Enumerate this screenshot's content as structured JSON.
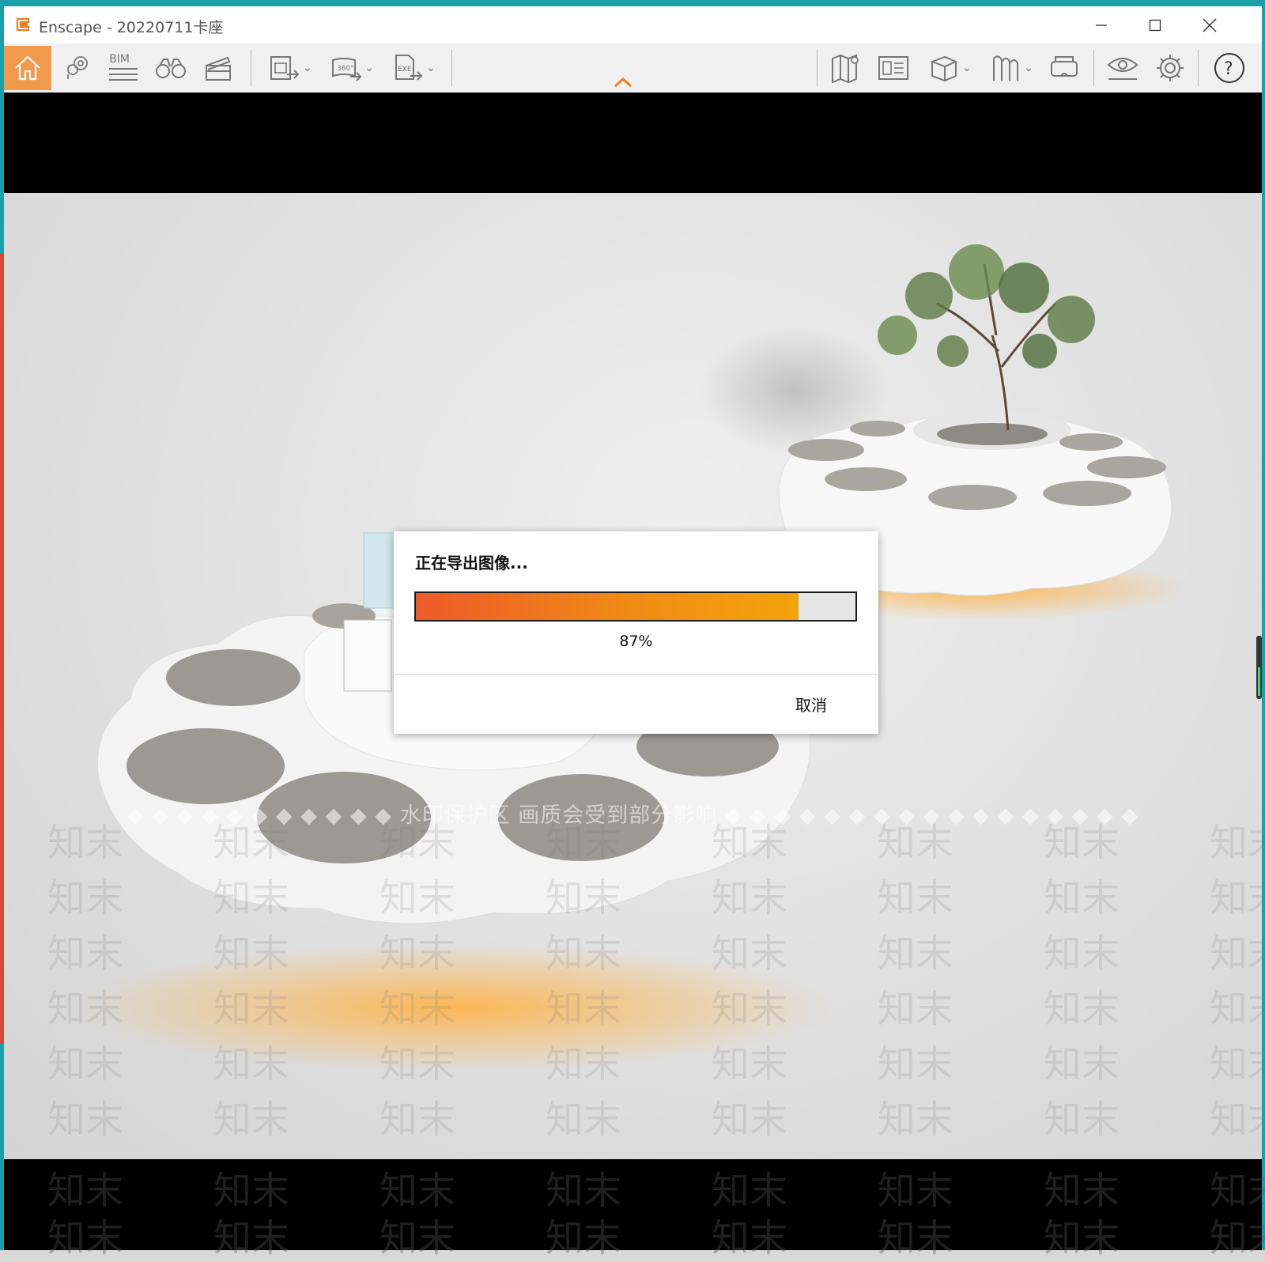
{
  "window": {
    "title": "Enscape - 20220711卡座",
    "minimize_icon": "minimize-icon",
    "maximize_icon": "maximize-icon",
    "close_icon": "close-icon"
  },
  "toolbar": {
    "left_tools": [
      "home-icon",
      "map-pin-icon",
      "bim-icon",
      "binoculars-icon",
      "clapperboard-icon"
    ],
    "bim_label": "BIM",
    "export_tools": [
      "export-image-icon",
      "export-360-icon",
      "export-exe-icon"
    ],
    "label_360": "360°",
    "label_exe": "EXE",
    "right_tools": [
      "map-icon",
      "panel-view-icon",
      "cube-icon",
      "asset-library-icon",
      "vr-headset-icon",
      "eye-icon",
      "gear-icon",
      "help-icon"
    ],
    "help_label": "?",
    "collapse_icon": "chevron-up-icon"
  },
  "colors": {
    "accent": "#f29a4b",
    "progress_start": "#ee5a2a",
    "progress_end": "#f3a40c",
    "desktop": "#1aa0a8"
  },
  "dialog": {
    "title": "正在导出图像...",
    "progress": 0.87,
    "progress_text": "87%",
    "cancel_label": "取消"
  },
  "watermark": {
    "banner": "◆ ◆ ◆ ◆ ◆ ◆ ◆ ◆ ◆ ◆ ◆ 水印保护区  画质会受到部分影响 ◆ ◆ ◆ ◆ ◆ ◆ ◆ ◆ ◆ ◆ ◆ ◆ ◆ ◆ ◆ ◆ ◆",
    "text": "知末"
  }
}
